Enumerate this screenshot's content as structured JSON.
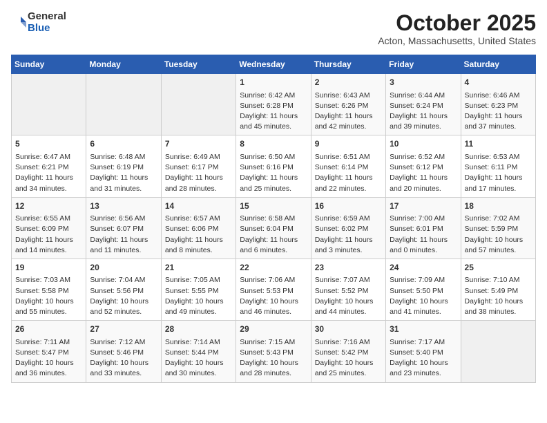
{
  "header": {
    "logo_general": "General",
    "logo_blue": "Blue",
    "month": "October 2025",
    "location": "Acton, Massachusetts, United States"
  },
  "days_of_week": [
    "Sunday",
    "Monday",
    "Tuesday",
    "Wednesday",
    "Thursday",
    "Friday",
    "Saturday"
  ],
  "weeks": [
    [
      {
        "day": "",
        "info": ""
      },
      {
        "day": "",
        "info": ""
      },
      {
        "day": "",
        "info": ""
      },
      {
        "day": "1",
        "info": "Sunrise: 6:42 AM\nSunset: 6:28 PM\nDaylight: 11 hours\nand 45 minutes."
      },
      {
        "day": "2",
        "info": "Sunrise: 6:43 AM\nSunset: 6:26 PM\nDaylight: 11 hours\nand 42 minutes."
      },
      {
        "day": "3",
        "info": "Sunrise: 6:44 AM\nSunset: 6:24 PM\nDaylight: 11 hours\nand 39 minutes."
      },
      {
        "day": "4",
        "info": "Sunrise: 6:46 AM\nSunset: 6:23 PM\nDaylight: 11 hours\nand 37 minutes."
      }
    ],
    [
      {
        "day": "5",
        "info": "Sunrise: 6:47 AM\nSunset: 6:21 PM\nDaylight: 11 hours\nand 34 minutes."
      },
      {
        "day": "6",
        "info": "Sunrise: 6:48 AM\nSunset: 6:19 PM\nDaylight: 11 hours\nand 31 minutes."
      },
      {
        "day": "7",
        "info": "Sunrise: 6:49 AM\nSunset: 6:17 PM\nDaylight: 11 hours\nand 28 minutes."
      },
      {
        "day": "8",
        "info": "Sunrise: 6:50 AM\nSunset: 6:16 PM\nDaylight: 11 hours\nand 25 minutes."
      },
      {
        "day": "9",
        "info": "Sunrise: 6:51 AM\nSunset: 6:14 PM\nDaylight: 11 hours\nand 22 minutes."
      },
      {
        "day": "10",
        "info": "Sunrise: 6:52 AM\nSunset: 6:12 PM\nDaylight: 11 hours\nand 20 minutes."
      },
      {
        "day": "11",
        "info": "Sunrise: 6:53 AM\nSunset: 6:11 PM\nDaylight: 11 hours\nand 17 minutes."
      }
    ],
    [
      {
        "day": "12",
        "info": "Sunrise: 6:55 AM\nSunset: 6:09 PM\nDaylight: 11 hours\nand 14 minutes."
      },
      {
        "day": "13",
        "info": "Sunrise: 6:56 AM\nSunset: 6:07 PM\nDaylight: 11 hours\nand 11 minutes."
      },
      {
        "day": "14",
        "info": "Sunrise: 6:57 AM\nSunset: 6:06 PM\nDaylight: 11 hours\nand 8 minutes."
      },
      {
        "day": "15",
        "info": "Sunrise: 6:58 AM\nSunset: 6:04 PM\nDaylight: 11 hours\nand 6 minutes."
      },
      {
        "day": "16",
        "info": "Sunrise: 6:59 AM\nSunset: 6:02 PM\nDaylight: 11 hours\nand 3 minutes."
      },
      {
        "day": "17",
        "info": "Sunrise: 7:00 AM\nSunset: 6:01 PM\nDaylight: 11 hours\nand 0 minutes."
      },
      {
        "day": "18",
        "info": "Sunrise: 7:02 AM\nSunset: 5:59 PM\nDaylight: 10 hours\nand 57 minutes."
      }
    ],
    [
      {
        "day": "19",
        "info": "Sunrise: 7:03 AM\nSunset: 5:58 PM\nDaylight: 10 hours\nand 55 minutes."
      },
      {
        "day": "20",
        "info": "Sunrise: 7:04 AM\nSunset: 5:56 PM\nDaylight: 10 hours\nand 52 minutes."
      },
      {
        "day": "21",
        "info": "Sunrise: 7:05 AM\nSunset: 5:55 PM\nDaylight: 10 hours\nand 49 minutes."
      },
      {
        "day": "22",
        "info": "Sunrise: 7:06 AM\nSunset: 5:53 PM\nDaylight: 10 hours\nand 46 minutes."
      },
      {
        "day": "23",
        "info": "Sunrise: 7:07 AM\nSunset: 5:52 PM\nDaylight: 10 hours\nand 44 minutes."
      },
      {
        "day": "24",
        "info": "Sunrise: 7:09 AM\nSunset: 5:50 PM\nDaylight: 10 hours\nand 41 minutes."
      },
      {
        "day": "25",
        "info": "Sunrise: 7:10 AM\nSunset: 5:49 PM\nDaylight: 10 hours\nand 38 minutes."
      }
    ],
    [
      {
        "day": "26",
        "info": "Sunrise: 7:11 AM\nSunset: 5:47 PM\nDaylight: 10 hours\nand 36 minutes."
      },
      {
        "day": "27",
        "info": "Sunrise: 7:12 AM\nSunset: 5:46 PM\nDaylight: 10 hours\nand 33 minutes."
      },
      {
        "day": "28",
        "info": "Sunrise: 7:14 AM\nSunset: 5:44 PM\nDaylight: 10 hours\nand 30 minutes."
      },
      {
        "day": "29",
        "info": "Sunrise: 7:15 AM\nSunset: 5:43 PM\nDaylight: 10 hours\nand 28 minutes."
      },
      {
        "day": "30",
        "info": "Sunrise: 7:16 AM\nSunset: 5:42 PM\nDaylight: 10 hours\nand 25 minutes."
      },
      {
        "day": "31",
        "info": "Sunrise: 7:17 AM\nSunset: 5:40 PM\nDaylight: 10 hours\nand 23 minutes."
      },
      {
        "day": "",
        "info": ""
      }
    ]
  ]
}
